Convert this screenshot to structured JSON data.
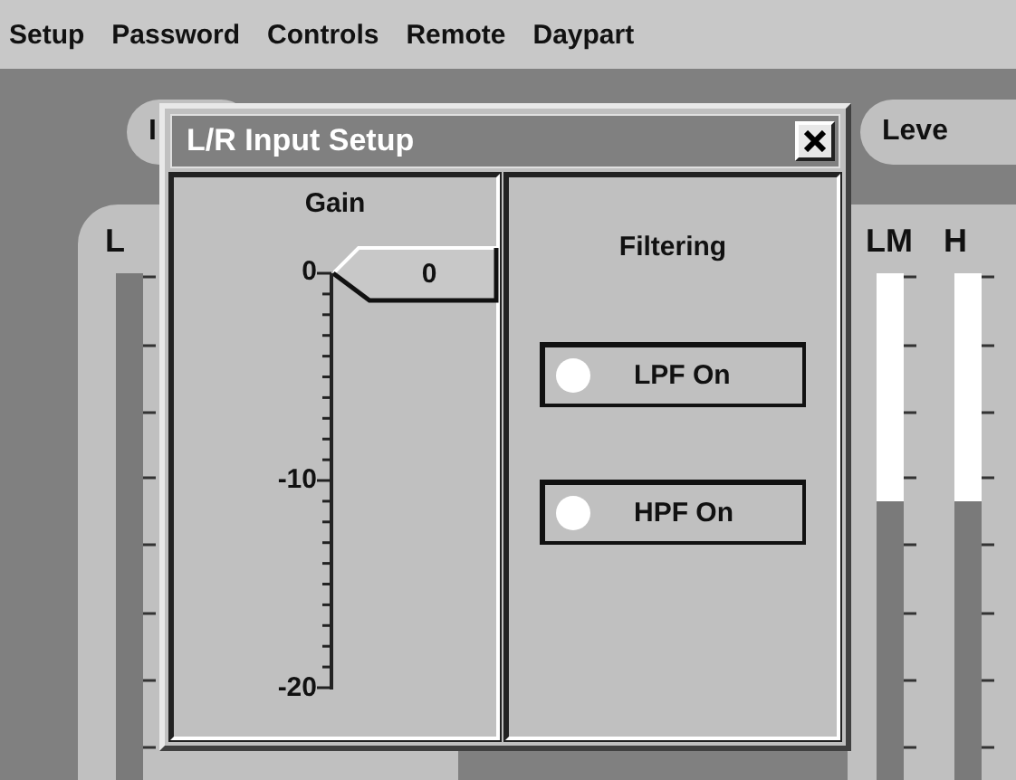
{
  "menu": [
    "Setup",
    "Password",
    "Controls",
    "Remote",
    "Daypart"
  ],
  "tabs": [
    "I",
    "Leve"
  ],
  "left_panel": {
    "label": "L",
    "meters": [
      {
        "level": 1
      }
    ]
  },
  "right_panel": {
    "meters": [
      {
        "label": "LM",
        "level": 0.58
      },
      {
        "label": "H",
        "level": 0.58
      }
    ]
  },
  "dialog": {
    "title": "L/R Input Setup",
    "gain": {
      "label": "Gain",
      "ticks": [
        "0",
        "-10",
        "-20"
      ],
      "value": "0",
      "level": 1
    },
    "filtering": {
      "label": "Filtering",
      "buttons": [
        "LPF On",
        "HPF On"
      ]
    }
  }
}
